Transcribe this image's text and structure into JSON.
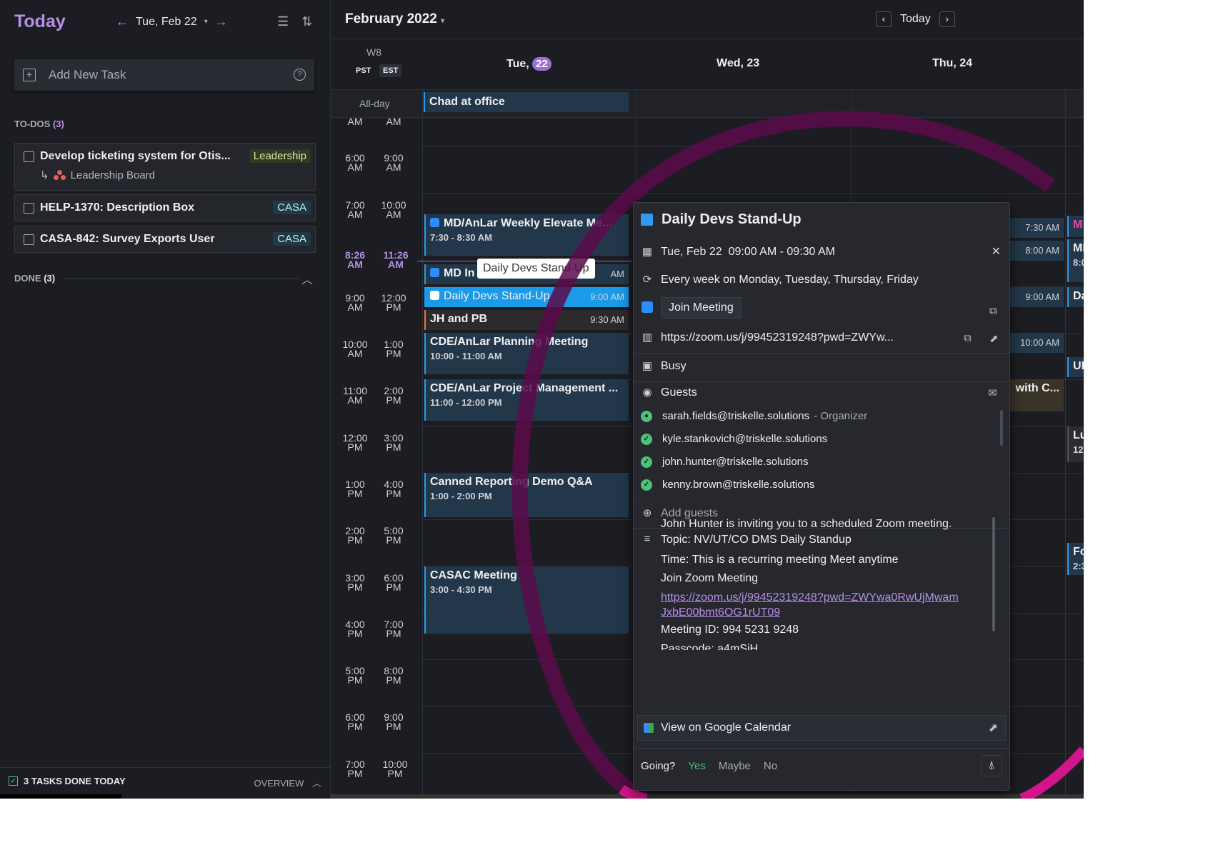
{
  "sidebar": {
    "title": "Today",
    "date_label": "Tue, Feb 22",
    "add_task_placeholder": "Add New Task",
    "todos_label": "TO-DOS",
    "todos_count": "(3)",
    "tasks": [
      {
        "title": "Develop ticketing system for Otis...",
        "tag": "Leadership",
        "sub": "Leadership Board"
      },
      {
        "title": "HELP-1370: Description Box",
        "tag": "CASA"
      },
      {
        "title": "CASA-842: Survey Exports User",
        "tag": "CASA"
      }
    ],
    "done_label": "DONE",
    "done_count": "(3)",
    "footer_left": "3 TASKS DONE TODAY",
    "footer_right": "OVERVIEW"
  },
  "calendar": {
    "month_title": "February 2022",
    "today_label": "Today",
    "week_label": "W8",
    "tz1": "PST",
    "tz2": "EST",
    "days": [
      {
        "name": "Tue,",
        "num": "22"
      },
      {
        "name": "Wed,",
        "num": "23"
      },
      {
        "name": "Thu,",
        "num": "24"
      }
    ],
    "allday_label": "All-day",
    "allday_event": "Chad at office",
    "time_rows": [
      [
        "AM",
        "AM"
      ],
      [
        "6:00 AM",
        "9:00 AM"
      ],
      [
        "7:00 AM",
        "10:00 AM"
      ],
      [
        "9:00 AM",
        "12:00 PM"
      ],
      [
        "10:00 AM",
        "1:00 PM"
      ],
      [
        "11:00 AM",
        "2:00 PM"
      ],
      [
        "12:00 PM",
        "3:00 PM"
      ],
      [
        "1:00 PM",
        "4:00 PM"
      ],
      [
        "2:00 PM",
        "5:00 PM"
      ],
      [
        "3:00 PM",
        "6:00 PM"
      ],
      [
        "4:00 PM",
        "7:00 PM"
      ],
      [
        "5:00 PM",
        "8:00 PM"
      ],
      [
        "6:00 PM",
        "9:00 PM"
      ],
      [
        "7:00 PM",
        "10:00 PM"
      ]
    ],
    "now_pst": "8:26 AM",
    "now_est": "11:26 AM",
    "events": [
      {
        "title": "MD/AnLar Weekly Elevate Me...",
        "time": "7:30 - 8:30 AM"
      },
      {
        "title": "MD In",
        "right": "AM"
      },
      {
        "title": "Daily Devs Stand-Up",
        "right": "9:00 AM"
      },
      {
        "title": "JH and PB",
        "right": "9:30 AM"
      },
      {
        "title": "CDE/AnLar Planning Meeting",
        "time": "10:00 - 11:00 AM"
      },
      {
        "title": "CDE/AnLar Project Management ...",
        "time": "11:00 - 12:00 PM"
      },
      {
        "title": "Canned Reporting Demo Q&A",
        "time": "1:00 - 2:00 PM"
      },
      {
        "title": "CASAC Meeting",
        "time": "3:00 - 4:30 PM"
      }
    ],
    "tooltip": "Daily Devs Stand-Up",
    "thu_events": [
      "7:30 AM",
      "8:00 AM",
      "9:00 AM",
      "10:00 AM",
      "with C..."
    ],
    "far_right": [
      "M",
      "MI",
      "8:0",
      "Da",
      "UP",
      "Lu",
      "12:",
      "Fo",
      "2:3"
    ]
  },
  "popup": {
    "title": "Daily Devs Stand-Up",
    "datetime": "Tue, Feb 22  09:00 AM - 09:30 AM",
    "recurrence": "Every week on Monday, Tuesday, Thursday, Friday",
    "join_label": "Join Meeting",
    "link": "https://zoom.us/j/99452319248?pwd=ZWYw...",
    "status": "Busy",
    "guests_label": "Guests",
    "guests": [
      {
        "email": "sarah.fields@triskelle.solutions",
        "role": "- Organizer"
      },
      {
        "email": "kyle.stankovich@triskelle.solutions"
      },
      {
        "email": "john.hunter@triskelle.solutions"
      },
      {
        "email": "kenny.brown@triskelle.solutions"
      }
    ],
    "add_guests": "Add guests",
    "description": [
      "John Hunter is inviting you to a scheduled Zoom meeting.",
      "Topic: NV/UT/CO DMS Daily Standup",
      "Time: This is a recurring meeting Meet anytime",
      "Join Zoom Meeting"
    ],
    "desc_link_1": "https://zoom.us/j/99452319248?pwd=ZWYwa0RwUjMwam",
    "desc_link_2": "JxbE00bmt6OG1rUT09",
    "meeting_id": "Meeting ID: 994 5231 9248",
    "passcode": "Passcode: a4mSiH",
    "gcal_label": "View on Google Calendar",
    "going_label": "Going?",
    "yes": "Yes",
    "maybe": "Maybe",
    "no": "No"
  },
  "colors": {
    "accent": "#b58ee6",
    "event_blue": "#2b9be8",
    "popup_bg": "#26282e"
  }
}
